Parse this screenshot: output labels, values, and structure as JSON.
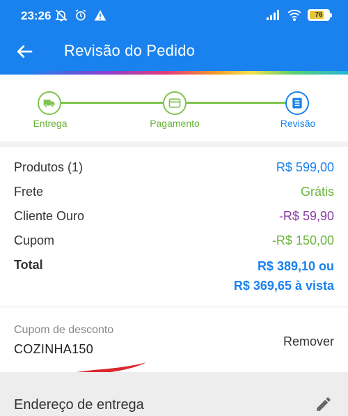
{
  "status_bar": {
    "time": "23:26",
    "battery_level": "76",
    "battery_fraction": 0.76,
    "icons": [
      "bell-off-icon",
      "alarm-icon",
      "warning-icon",
      "signal-icon",
      "wifi-icon",
      "battery-icon"
    ]
  },
  "app_bar": {
    "title": "Revisão do Pedido",
    "back_icon": "arrow-left-icon",
    "color": "#1a82ee"
  },
  "stepper": {
    "steps": [
      {
        "label": "Entrega",
        "icon": "truck-icon",
        "state": "done"
      },
      {
        "label": "Pagamento",
        "icon": "card-icon",
        "state": "done"
      },
      {
        "label": "Revisão",
        "icon": "list-icon",
        "state": "current"
      }
    ],
    "done_color": "#7ec44f",
    "current_color": "#1a82ee"
  },
  "summary": {
    "products_label": "Produtos (1)",
    "products_value": "R$ 599,00",
    "shipping_label": "Frete",
    "shipping_value": "Grátis",
    "gold_label": "Cliente Ouro",
    "gold_value": "-R$ 59,90",
    "coupon_label": "Cupom",
    "coupon_value": "-R$ 150,00",
    "total_label": "Total",
    "total_value_line1": "R$ 389,10 ou",
    "total_value_line2": "R$ 369,65 à vista"
  },
  "coupon": {
    "label": "Cupom de desconto",
    "code": "COZINHA150",
    "remove_label": "Remover"
  },
  "address": {
    "title": "Endereço de entrega",
    "edit_icon": "pencil-icon"
  }
}
